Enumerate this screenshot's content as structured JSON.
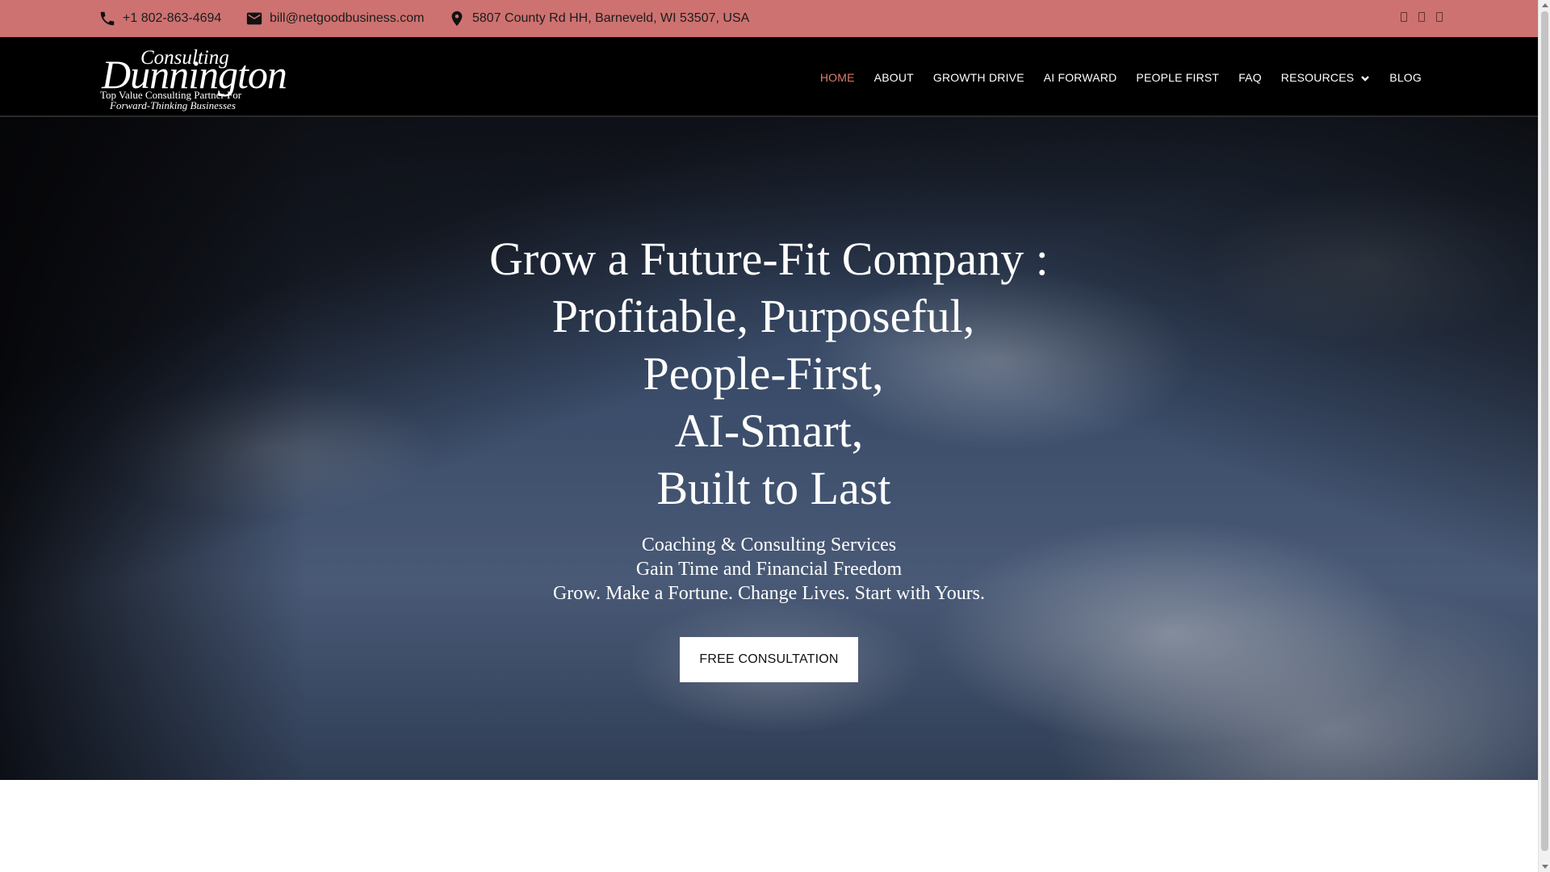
{
  "topbar": {
    "phone": "+1 802-863-4694",
    "email": "bill@netgoodbusiness.com",
    "address": "5807 County Rd HH, Barneveld, WI 53507, USA",
    "background": "#cd7270"
  },
  "logo": {
    "line1": "Consulting",
    "line2": "Dunnington",
    "line3": "Top Value Consulting Partner For",
    "line4": "Forward-Thinking Businesses"
  },
  "nav": {
    "items": [
      {
        "label": "HOME"
      },
      {
        "label": "ABOUT"
      },
      {
        "label": "GROWTH DRIVE"
      },
      {
        "label": "AI FORWARD"
      },
      {
        "label": "PEOPLE FIRST"
      },
      {
        "label": "FAQ"
      },
      {
        "label": "RESOURCES"
      },
      {
        "label": "BLOG"
      }
    ],
    "active_color": "#e27b6f"
  },
  "hero": {
    "title_lines": [
      "Grow a Future-Fit Company :",
      "Profitable, Purposeful,",
      "People-First,",
      "AI-Smart,",
      "Built to Last"
    ],
    "subtitle_lines": [
      "Coaching & Consulting Services",
      "Gain Time and Financial Freedom",
      "Grow. Make a Fortune. Change Lives. Start with Yours."
    ],
    "cta_label": "FREE CONSULTATION"
  }
}
